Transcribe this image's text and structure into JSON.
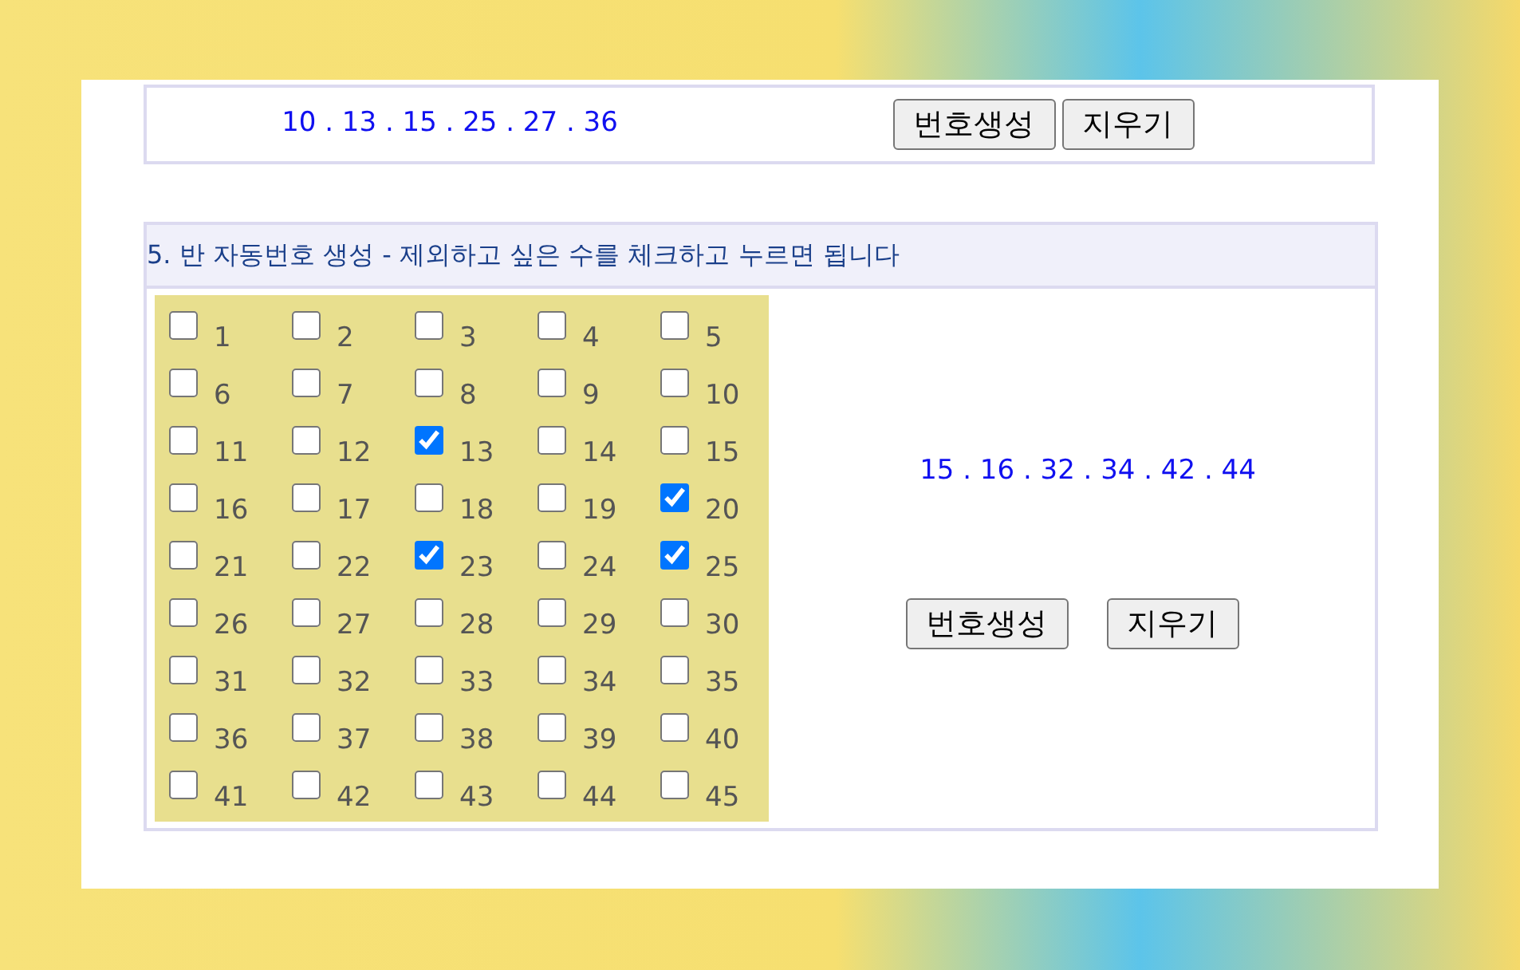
{
  "top_section": {
    "numbers": "10 . 13 . 15 . 25 . 27 . 36",
    "buttons": [
      "번호생성",
      "지우기"
    ]
  },
  "section_5": {
    "title": "5. 반 자동번호 생성 - 제외하고 싶은 수를 체크하고 누르면 됩니다",
    "checkboxes": [
      {
        "label": "1",
        "checked": false
      },
      {
        "label": "2",
        "checked": false
      },
      {
        "label": "3",
        "checked": false
      },
      {
        "label": "4",
        "checked": false
      },
      {
        "label": "5",
        "checked": false
      },
      {
        "label": "6",
        "checked": false
      },
      {
        "label": "7",
        "checked": false
      },
      {
        "label": "8",
        "checked": false
      },
      {
        "label": "9",
        "checked": false
      },
      {
        "label": "10",
        "checked": false
      },
      {
        "label": "11",
        "checked": false
      },
      {
        "label": "12",
        "checked": false
      },
      {
        "label": "13",
        "checked": true
      },
      {
        "label": "14",
        "checked": false
      },
      {
        "label": "15",
        "checked": false
      },
      {
        "label": "16",
        "checked": false
      },
      {
        "label": "17",
        "checked": false
      },
      {
        "label": "18",
        "checked": false
      },
      {
        "label": "19",
        "checked": false
      },
      {
        "label": "20",
        "checked": true
      },
      {
        "label": "21",
        "checked": false
      },
      {
        "label": "22",
        "checked": false
      },
      {
        "label": "23",
        "checked": true
      },
      {
        "label": "24",
        "checked": false
      },
      {
        "label": "25",
        "checked": true
      },
      {
        "label": "26",
        "checked": false
      },
      {
        "label": "27",
        "checked": false
      },
      {
        "label": "28",
        "checked": false
      },
      {
        "label": "29",
        "checked": false
      },
      {
        "label": "30",
        "checked": false
      },
      {
        "label": "31",
        "checked": false
      },
      {
        "label": "32",
        "checked": false
      },
      {
        "label": "33",
        "checked": false
      },
      {
        "label": "34",
        "checked": false
      },
      {
        "label": "35",
        "checked": false
      },
      {
        "label": "36",
        "checked": false
      },
      {
        "label": "37",
        "checked": false
      },
      {
        "label": "38",
        "checked": false
      },
      {
        "label": "39",
        "checked": false
      },
      {
        "label": "40",
        "checked": false
      },
      {
        "label": "41",
        "checked": false
      },
      {
        "label": "42",
        "checked": false
      },
      {
        "label": "43",
        "checked": false
      },
      {
        "label": "44",
        "checked": false
      },
      {
        "label": "45",
        "checked": false
      }
    ],
    "numbers": "15 . 16 . 32 . 34 . 42 . 44",
    "buttons": [
      "번호생성",
      "지우기"
    ]
  }
}
